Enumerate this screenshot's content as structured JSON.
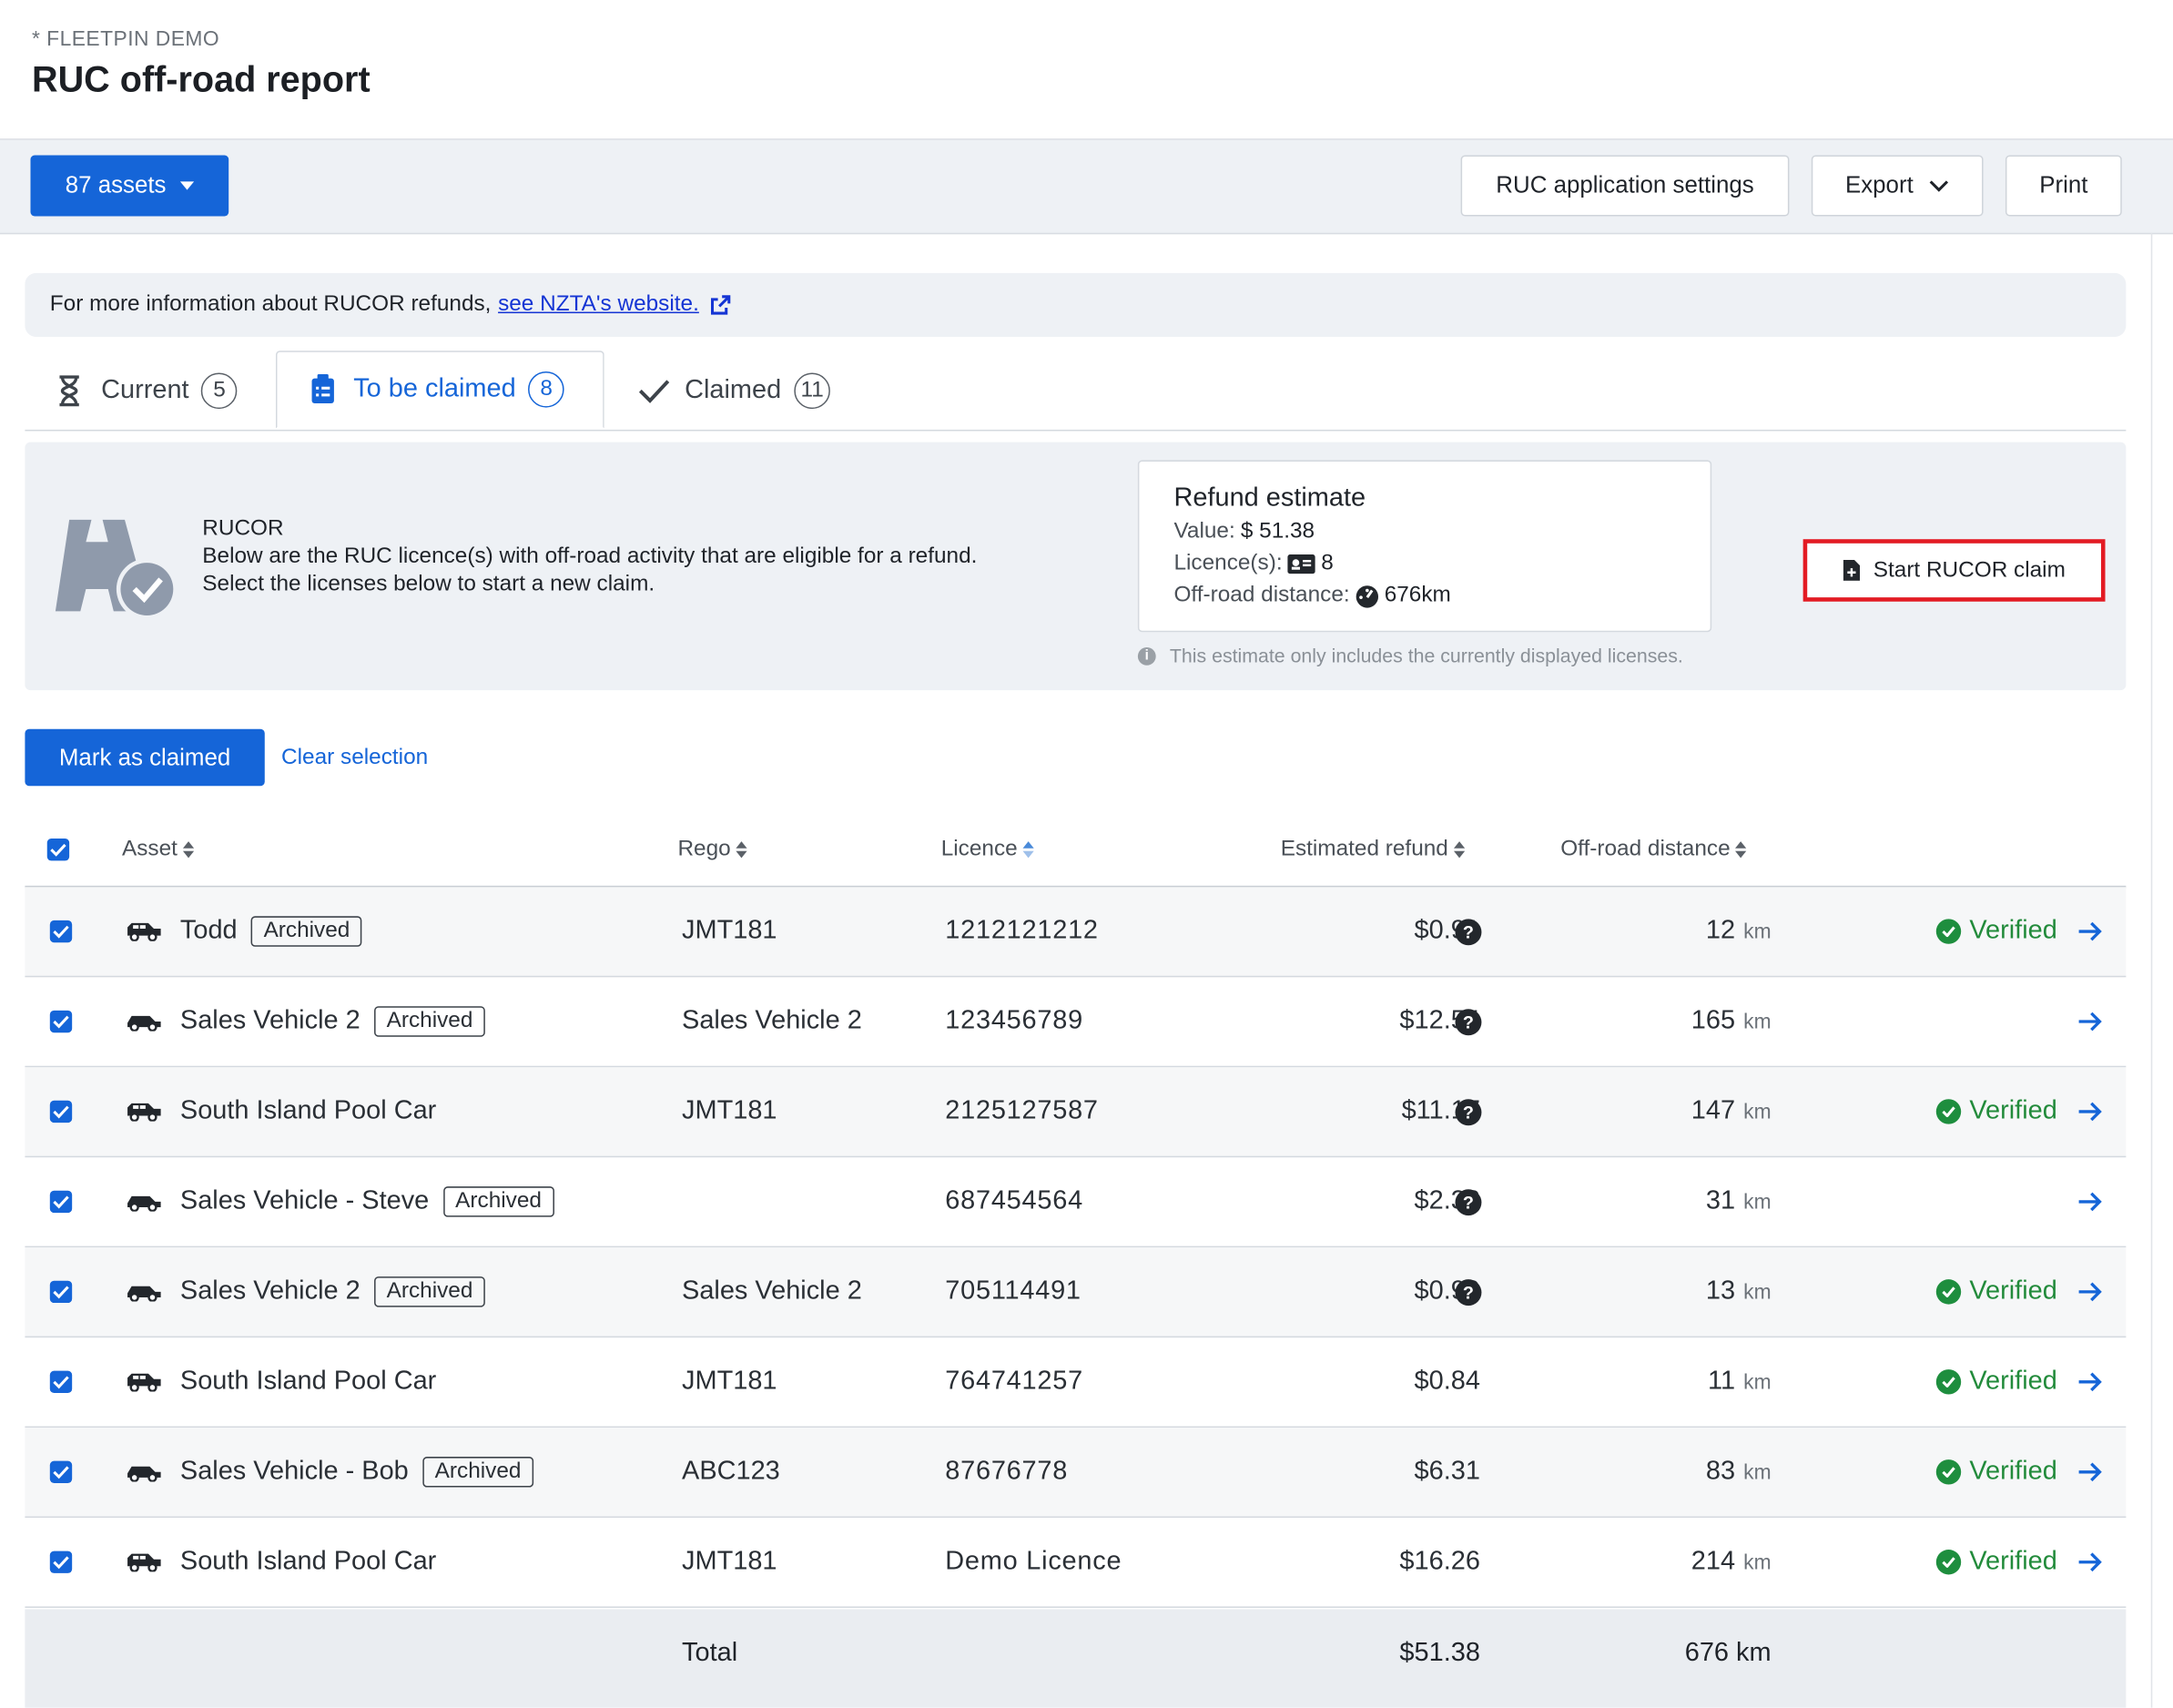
{
  "header": {
    "org": "* FLEETPIN DEMO",
    "title": "RUC off-road report"
  },
  "toolbar": {
    "assets_label": "87 assets",
    "settings_label": "RUC application settings",
    "export_label": "Export",
    "print_label": "Print"
  },
  "info": {
    "text": "For more information about RUCOR refunds,",
    "link_text": "see NZTA's website."
  },
  "tabs": [
    {
      "label": "Current",
      "count": "5"
    },
    {
      "label": "To be claimed",
      "count": "8"
    },
    {
      "label": "Claimed",
      "count": "11"
    }
  ],
  "panel": {
    "title": "RUCOR",
    "line1": "Below are the RUC licence(s) with off-road activity that are eligible for a refund.",
    "line2": "Select the licenses below to start a new claim.",
    "refund_title": "Refund estimate",
    "value_label": "Value:",
    "value": "$ 51.38",
    "licences_label": "Licence(s):",
    "licences": "8",
    "distance_label": "Off-road distance:",
    "distance": "676km",
    "note": "This estimate only includes the currently displayed licenses.",
    "start_label": "Start RUCOR claim"
  },
  "actions": {
    "mark_label": "Mark as claimed",
    "clear_label": "Clear selection"
  },
  "columns": {
    "asset": "Asset",
    "rego": "Rego",
    "licence": "Licence",
    "refund": "Estimated refund",
    "distance": "Off-road distance"
  },
  "rows": [
    {
      "asset": "Todd",
      "archived": "Archived",
      "rego": "JMT181",
      "licence": "1212121212",
      "refund": "$0.91",
      "help": true,
      "distance": "12",
      "unit": "km",
      "status": "Verified"
    },
    {
      "asset": "Sales Vehicle 2",
      "archived": "Archived",
      "rego": "Sales Vehicle 2",
      "licence": "123456789",
      "refund": "$12.54",
      "help": true,
      "distance": "165",
      "unit": "km",
      "status": ""
    },
    {
      "asset": "South Island Pool Car",
      "archived": "",
      "rego": "JMT181",
      "licence": "2125127587",
      "refund": "$11.17",
      "help": true,
      "distance": "147",
      "unit": "km",
      "status": "Verified"
    },
    {
      "asset": "Sales Vehicle - Steve",
      "archived": "Archived",
      "rego": "",
      "licence": "687454564",
      "refund": "$2.36",
      "help": true,
      "distance": "31",
      "unit": "km",
      "status": ""
    },
    {
      "asset": "Sales Vehicle 2",
      "archived": "Archived",
      "rego": "Sales Vehicle 2",
      "licence": "705114491",
      "refund": "$0.99",
      "help": true,
      "distance": "13",
      "unit": "km",
      "status": "Verified"
    },
    {
      "asset": "South Island Pool Car",
      "archived": "",
      "rego": "JMT181",
      "licence": "764741257",
      "refund": "$0.84",
      "help": false,
      "distance": "11",
      "unit": "km",
      "status": "Verified"
    },
    {
      "asset": "Sales Vehicle - Bob",
      "archived": "Archived",
      "rego": "ABC123",
      "licence": "87676778",
      "refund": "$6.31",
      "help": false,
      "distance": "83",
      "unit": "km",
      "status": "Verified"
    },
    {
      "asset": "South Island Pool Car",
      "archived": "",
      "rego": "JMT181",
      "licence": "Demo Licence",
      "refund": "$16.26",
      "help": false,
      "distance": "214",
      "unit": "km",
      "status": "Verified"
    }
  ],
  "total": {
    "label": "Total",
    "refund": "$51.38",
    "distance": "676 km"
  },
  "colors": {
    "primary": "#1565d8",
    "verified": "#1e8e3e",
    "highlight": "#e31b23"
  }
}
